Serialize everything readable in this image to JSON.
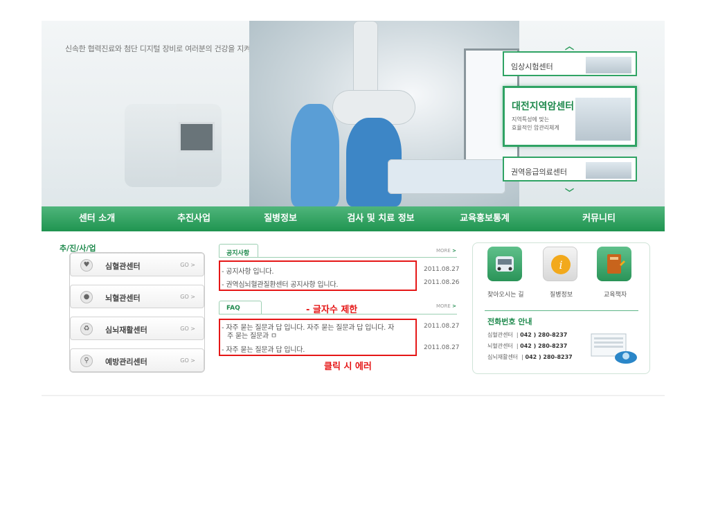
{
  "hero": {
    "tagline": "신속한 협력진료와 첨단 디지털 장비로 여러분의 건강을 지켜드립니다."
  },
  "side_centers": {
    "up_icon": "chevron-up-icon",
    "down_icon": "chevron-down-icon",
    "items": [
      {
        "title": "임상시험센터"
      },
      {
        "title": "대전지역암센터",
        "sub1": "지역특성에 맞는",
        "sub2": "효율적인 암관리체계"
      },
      {
        "title": "권역응급의료센터"
      }
    ]
  },
  "nav": {
    "items": [
      "센터 소개",
      "추진사업",
      "질병정보",
      "검사 및 치료 정보",
      "교육홍보통계",
      "커뮤니티"
    ]
  },
  "business": {
    "title": "추/진/사/업",
    "items": [
      {
        "label": "심혈관센터",
        "go": "GO >",
        "icon": "heart-icon"
      },
      {
        "label": "뇌혈관센터",
        "go": "GO >",
        "icon": "brain-icon"
      },
      {
        "label": "심뇌재활센터",
        "go": "GO >",
        "icon": "recycle-icon"
      },
      {
        "label": "예방관리센터",
        "go": "GO >",
        "icon": "magnifier-icon"
      }
    ]
  },
  "notice": {
    "tab": "공지사항",
    "more": "MORE",
    "rows": [
      {
        "text": "- 공지사항 입니다.",
        "date": "2011.08.27"
      },
      {
        "text": "- 권역심뇌혈관질환센터 공지사항 입니다.",
        "date": "2011.08.26"
      }
    ]
  },
  "faq": {
    "tab": "FAQ",
    "more": "MORE",
    "rows": [
      {
        "text1": "- 자주 묻는 질문과 답 입니다. 자주 묻는 질문과 답 입니다. 자",
        "text2": "주 묻는 질문과 ㅁ",
        "date": "2011.08.27"
      },
      {
        "text1": "- 자주 묻는 질문과 답 입니다.",
        "date": "2011.08.27"
      }
    ]
  },
  "annotations": {
    "limit": "- 글자수 제한",
    "click_error": "클릭 시 에러"
  },
  "quick": {
    "items": [
      {
        "label": "찾아오시는 길",
        "icon": "car-icon",
        "color": "#2fa364"
      },
      {
        "label": "질병정보",
        "icon": "info-icon",
        "color": "#f2a91c"
      },
      {
        "label": "교육책자",
        "icon": "book-icon",
        "color": "#c8641c"
      }
    ],
    "phone_title": "전화번호 안내",
    "phones": [
      {
        "name": "심혈관센터",
        "number": "042 ) 280-8237"
      },
      {
        "name": "뇌혈관센터",
        "number": "042 ) 280-8237"
      },
      {
        "name": "심뇌재활센터",
        "number": "042 ) 280-8237"
      }
    ],
    "phone_icon": "telephone-icon"
  }
}
